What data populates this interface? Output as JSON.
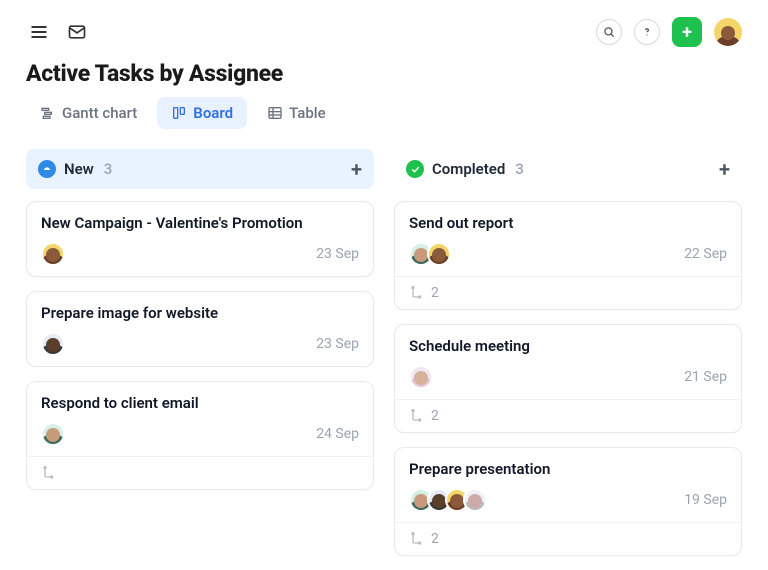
{
  "header": {
    "title": "Active Tasks by Assignee"
  },
  "views": {
    "gantt": "Gantt chart",
    "board": "Board",
    "table": "Table",
    "active": "board"
  },
  "columns": [
    {
      "key": "new",
      "name": "New",
      "count": "3",
      "status": "new",
      "cards": [
        {
          "title": "New Campaign - Valentine's Promotion",
          "date": "23 Sep",
          "avatars": [
            "a"
          ],
          "subtasks": null
        },
        {
          "title": "Prepare image for website",
          "date": "23 Sep",
          "avatars": [
            "d"
          ],
          "subtasks": null
        },
        {
          "title": "Respond to client email",
          "date": "24 Sep",
          "avatars": [
            "b"
          ],
          "subtasks": ""
        }
      ]
    },
    {
      "key": "completed",
      "name": "Completed",
      "count": "3",
      "status": "done",
      "cards": [
        {
          "title": "Send out report",
          "date": "22 Sep",
          "avatars": [
            "b",
            "a"
          ],
          "subtasks": "2"
        },
        {
          "title": "Schedule meeting",
          "date": "21 Sep",
          "avatars": [
            "c"
          ],
          "subtasks": "2"
        },
        {
          "title": "Prepare presentation",
          "date": "19 Sep",
          "avatars": [
            "b",
            "d",
            "a",
            "e"
          ],
          "subtasks": "2"
        }
      ]
    }
  ]
}
